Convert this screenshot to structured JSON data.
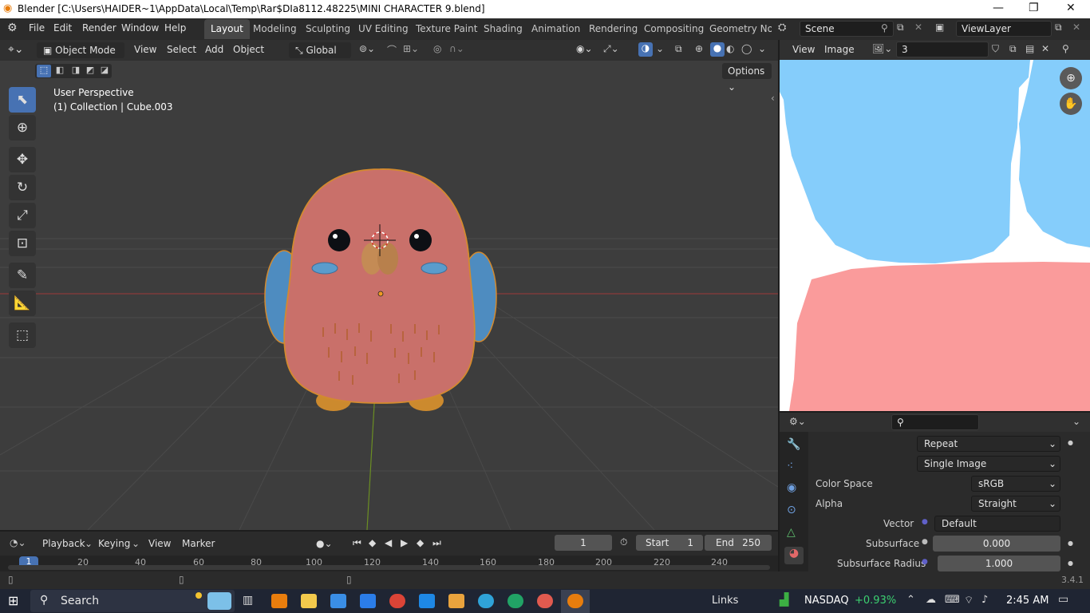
{
  "window": {
    "title": "Blender [C:\\Users\\HAIDER~1\\AppData\\Local\\Temp\\Rar$DIa8112.48225\\MINI CHARACTER 9.blend]"
  },
  "menubar": {
    "items": [
      "File",
      "Edit",
      "Render",
      "Window",
      "Help"
    ]
  },
  "workspaces": [
    {
      "label": "Layout",
      "active": true
    },
    {
      "label": "Modeling"
    },
    {
      "label": "Sculpting"
    },
    {
      "label": "UV Editing"
    },
    {
      "label": "Texture Paint"
    },
    {
      "label": "Shading"
    },
    {
      "label": "Animation"
    },
    {
      "label": "Rendering"
    },
    {
      "label": "Compositing"
    },
    {
      "label": "Geometry Noc"
    }
  ],
  "scene": {
    "name": "Scene",
    "view_layer": "ViewLayer"
  },
  "viewport": {
    "mode": "Object Mode",
    "menus": [
      "View",
      "Select",
      "Add",
      "Object"
    ],
    "transform_orientation": "Global",
    "options_label": "Options",
    "overlay_title": "User Perspective",
    "overlay_collection": "(1) Collection | Cube.003"
  },
  "image_editor": {
    "menus": [
      "View",
      "Image"
    ],
    "image_name": "3"
  },
  "properties": {
    "rows": [
      {
        "label": "",
        "value": "Repeat"
      },
      {
        "label": "",
        "value": "Single Image"
      },
      {
        "label": "Color Space",
        "value": "sRGB"
      },
      {
        "label": "Alpha",
        "value": "Straight"
      },
      {
        "label": "Vector",
        "value": "Default"
      },
      {
        "label": "Subsurface",
        "value": "0.000"
      },
      {
        "label": "Subsurface Radius",
        "value": "1.000"
      }
    ]
  },
  "timeline": {
    "menus": [
      "Playback",
      "Keying",
      "View",
      "Marker"
    ],
    "current_frame": "1",
    "start_label": "Start",
    "start": "1",
    "end_label": "End",
    "end": "250",
    "ruler": [
      "1",
      "20",
      "40",
      "60",
      "80",
      "100",
      "120",
      "140",
      "160",
      "180",
      "200",
      "220",
      "240"
    ]
  },
  "status": {
    "version": "3.4.1"
  },
  "taskbar": {
    "search": "Search",
    "links": "Links",
    "ticker": "NASDAQ",
    "ticker_change": "+0.93%",
    "time": "2:45 AM"
  },
  "colors": {
    "accent": "#4772b3",
    "body": "#c9706a",
    "wing": "#4e8cc0",
    "uv_blue": "#85cdfb",
    "uv_pink": "#fa9b9b"
  }
}
